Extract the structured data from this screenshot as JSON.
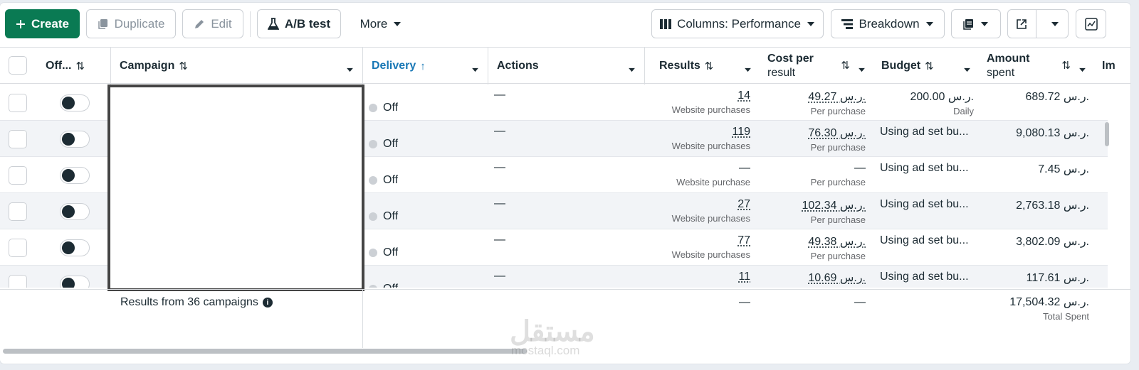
{
  "toolbar": {
    "create": "Create",
    "duplicate": "Duplicate",
    "edit": "Edit",
    "ab_test": "A/B test",
    "more": "More",
    "columns": "Columns: Performance",
    "breakdown": "Breakdown"
  },
  "columns": {
    "off": "Off...",
    "campaign": "Campaign",
    "delivery": "Delivery",
    "actions": "Actions",
    "results": "Results",
    "cost_per_result_1": "Cost per",
    "cost_per_result_2": "result",
    "budget": "Budget",
    "amount_spent_1": "Amount",
    "amount_spent_2": "spent",
    "next": "Im"
  },
  "rows": [
    {
      "delivery": "Off",
      "actions": "—",
      "results": "14",
      "results_sub": "Website purchases",
      "cpr": "49.27 ر.س.",
      "cpr_sub": "Per purchase",
      "budget": "200.00 ر.س.",
      "budget_sub": "Daily",
      "spent": "689.72 ر.س."
    },
    {
      "delivery": "Off",
      "actions": "—",
      "results": "119",
      "results_sub": "Website purchases",
      "cpr": "76.30 ر.س.",
      "cpr_sub": "Per purchase",
      "budget": "Using ad set bu...",
      "budget_sub": "",
      "spent": "9,080.13 ر.س."
    },
    {
      "delivery": "Off",
      "actions": "—",
      "results": "—",
      "results_sub": "Website purchase",
      "cpr": "—",
      "cpr_sub": "Per purchase",
      "budget": "Using ad set bu...",
      "budget_sub": "",
      "spent": "7.45 ر.س."
    },
    {
      "delivery": "Off",
      "actions": "—",
      "results": "27",
      "results_sub": "Website purchases",
      "cpr": "102.34 ر.س.",
      "cpr_sub": "Per purchase",
      "budget": "Using ad set bu...",
      "budget_sub": "",
      "spent": "2,763.18 ر.س."
    },
    {
      "delivery": "Off",
      "actions": "—",
      "results": "77",
      "results_sub": "Website purchases",
      "cpr": "49.38 ر.س.",
      "cpr_sub": "Per purchase",
      "budget": "Using ad set bu...",
      "budget_sub": "",
      "spent": "3,802.09 ر.س."
    },
    {
      "delivery": "Off",
      "actions": "—",
      "results": "11",
      "results_sub": "",
      "cpr": "10.69 ر.س.",
      "cpr_sub": "",
      "budget": "Using ad set bu...",
      "budget_sub": "",
      "spent": "117.61 ر.س."
    }
  ],
  "footer": {
    "summary": "Results from 36 campaigns",
    "results": "—",
    "cpr": "—",
    "spent": "17,504.32 ر.س.",
    "spent_sub": "Total Spent"
  },
  "watermark": {
    "arabic": "مستقل",
    "latin": "mostaql.com"
  }
}
